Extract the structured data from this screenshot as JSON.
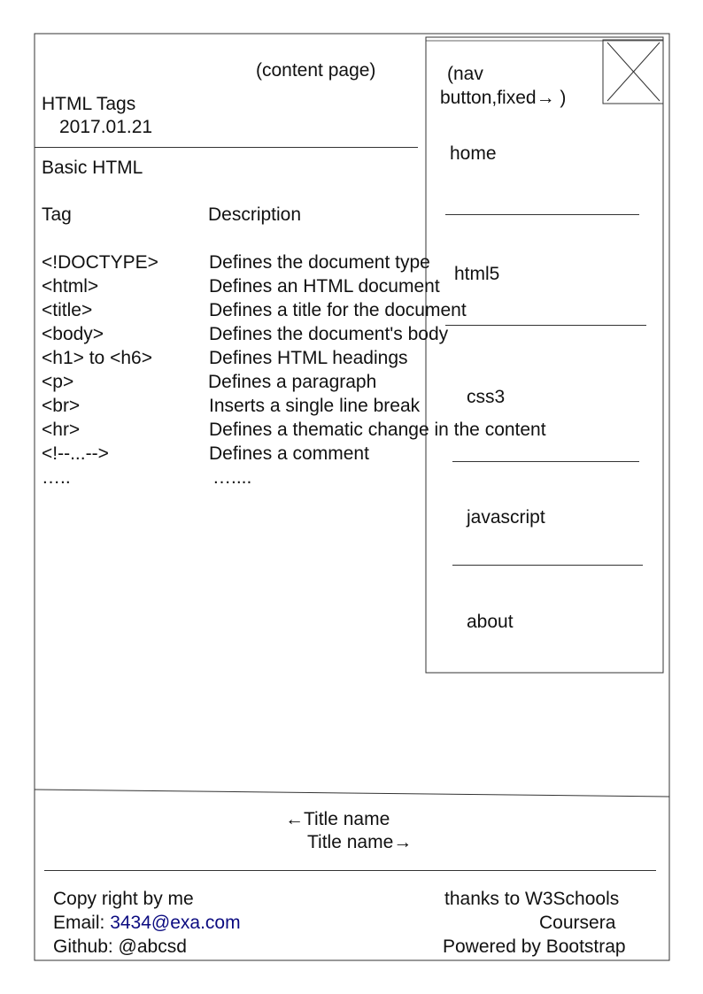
{
  "content_label": "(content page)",
  "header": {
    "title": "HTML Tags",
    "date": "2017.01.21"
  },
  "section_title": "Basic HTML",
  "table": {
    "headers": [
      "Tag",
      "Description"
    ],
    "rows": [
      [
        "<!DOCTYPE>",
        "Defines the document type"
      ],
      [
        "<html>",
        "Defines an HTML document"
      ],
      [
        "<title>",
        "Defines a title for the document"
      ],
      [
        "<body>",
        "Defines the document's body"
      ],
      [
        "<h1> to <h6>",
        "Defines HTML headings"
      ],
      [
        "<p>",
        "Defines a paragraph"
      ],
      [
        "<br>",
        "Inserts a single line break"
      ],
      [
        "<hr>",
        "Defines a thematic change in the content"
      ],
      [
        "<!--...-->",
        "Defines a comment"
      ],
      [
        "…..",
        "…...."
      ]
    ]
  },
  "nav": {
    "label_line1": "(nav",
    "label_line2": "button,fixed→ )",
    "items": [
      "home",
      "html5",
      "css3",
      "javascript",
      "about"
    ]
  },
  "pager": {
    "prev": "←Title name",
    "next": "Title name→"
  },
  "footer": {
    "copyright": "Copy right by me",
    "email_label": "Email: ",
    "email": "3434@exa.com",
    "github": "Github: @abcsd",
    "thanks": "thanks to W3Schools",
    "coursera": "Coursera",
    "powered": "Powered by Bootstrap"
  },
  "colors": {
    "link": "#0b0b80"
  }
}
